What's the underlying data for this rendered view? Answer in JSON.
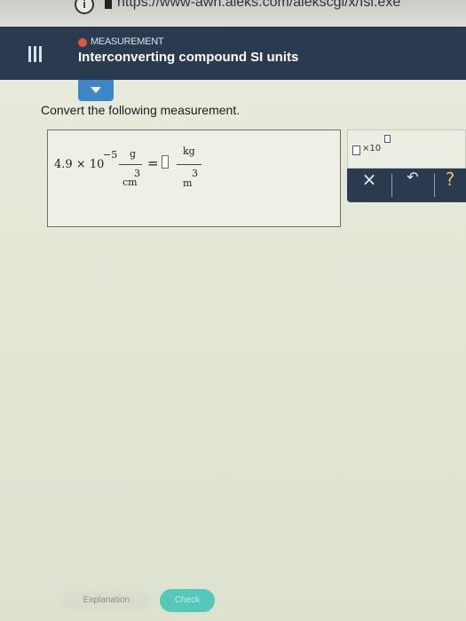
{
  "browser": {
    "info_glyph": "i",
    "url": "https://www-awn.aleks.com/alekscgi/x/Isl.exe"
  },
  "header": {
    "module": "MEASUREMENT",
    "topic": "Interconverting compound SI units",
    "menu_icon": "hamburger-menu-icon",
    "status_color": "#e0583a"
  },
  "question": {
    "prompt": "Convert the following measurement.",
    "coefficient": "4.9 × 10",
    "exponent": "−5",
    "from_unit_num": "g",
    "from_unit_den": "cm",
    "from_unit_den_power": "3",
    "equals": "=",
    "to_unit_num": "kg",
    "to_unit_den": "m",
    "to_unit_den_power": "3"
  },
  "palette": {
    "sci_label": "×10",
    "clear": "×",
    "undo": "↶",
    "help": "?"
  },
  "footer": {
    "explanation": "Explanation",
    "check": "Check"
  },
  "colors": {
    "header_bg": "#2a3b4f",
    "accent_blue": "#3f86c8",
    "check_teal": "#54c8b9",
    "help_yellow": "#e6c04c"
  }
}
